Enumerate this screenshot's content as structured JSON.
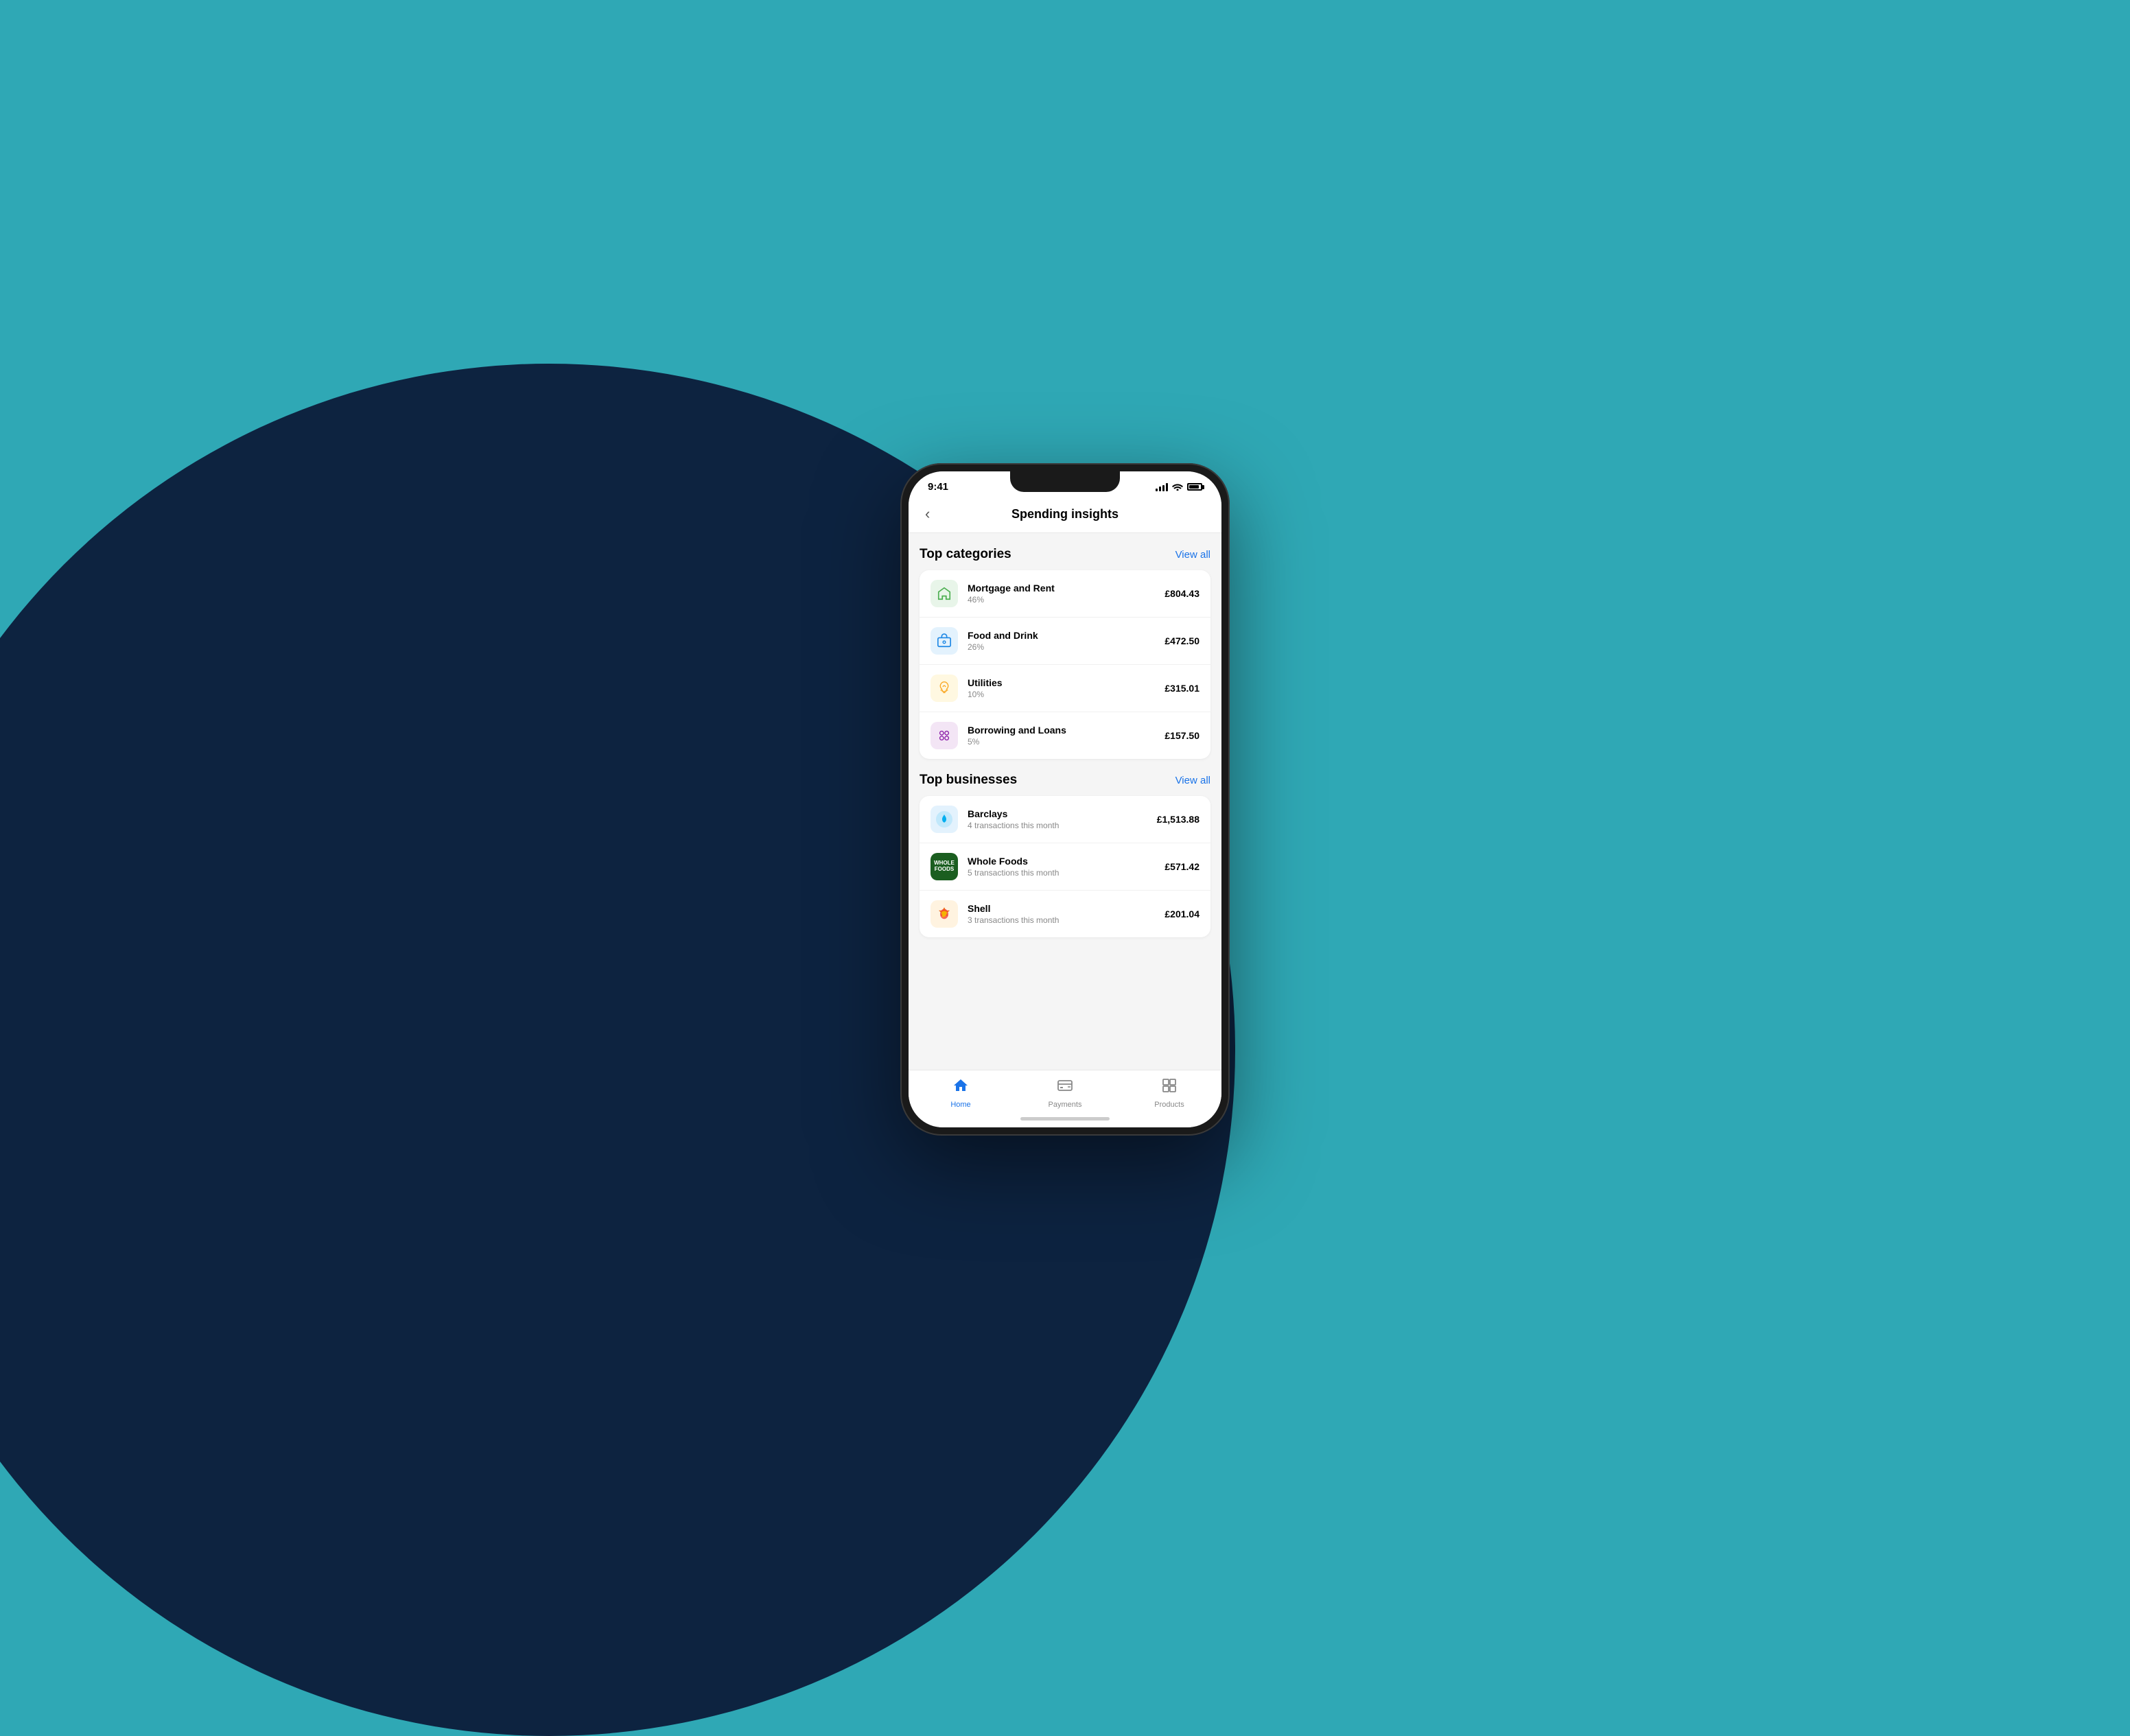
{
  "background": {
    "primary_color": "#2fa8b5",
    "dark_circle_color": "#0d2340"
  },
  "phone": {
    "status_bar": {
      "time": "9:41",
      "signal": true,
      "wifi": true,
      "battery": true
    },
    "header": {
      "back_label": "‹",
      "title": "Spending insights"
    },
    "sections": {
      "top_categories": {
        "title": "Top categories",
        "view_all_label": "View all",
        "items": [
          {
            "name": "Mortgage and Rent",
            "subtitle": "46%",
            "amount": "£804.43",
            "icon_type": "mortgage"
          },
          {
            "name": "Food and Drink",
            "subtitle": "26%",
            "amount": "£472.50",
            "icon_type": "food"
          },
          {
            "name": "Utilities",
            "subtitle": "10%",
            "amount": "£315.01",
            "icon_type": "utilities"
          },
          {
            "name": "Borrowing and Loans",
            "subtitle": "5%",
            "amount": "£157.50",
            "icon_type": "borrowing"
          }
        ]
      },
      "top_businesses": {
        "title": "Top businesses",
        "view_all_label": "View all",
        "items": [
          {
            "name": "Barclays",
            "subtitle": "4 transactions this month",
            "amount": "£1,513.88",
            "icon_type": "barclays"
          },
          {
            "name": "Whole Foods",
            "subtitle": "5 transactions this month",
            "amount": "£571.42",
            "icon_type": "wholefoods"
          },
          {
            "name": "Shell",
            "subtitle": "3 transactions this month",
            "amount": "£201.04",
            "icon_type": "shell"
          }
        ]
      }
    },
    "bottom_nav": {
      "items": [
        {
          "label": "Home",
          "icon": "home",
          "active": true
        },
        {
          "label": "Payments",
          "icon": "payments",
          "active": false
        },
        {
          "label": "Products",
          "icon": "products",
          "active": false
        }
      ]
    }
  }
}
